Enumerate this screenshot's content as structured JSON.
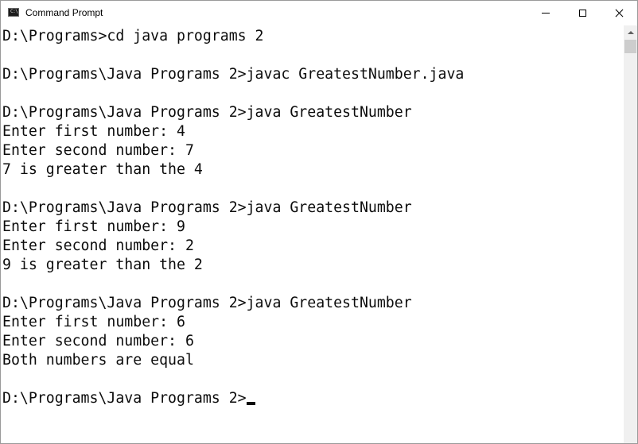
{
  "window": {
    "title": "Command Prompt",
    "icon_name": "command-prompt-icon",
    "icon_glyph": "C:\\",
    "controls": {
      "minimize": "minimize-icon",
      "maximize": "maximize-icon",
      "close": "close-icon"
    }
  },
  "console": {
    "lines": [
      "D:\\Programs>cd java programs 2",
      "",
      "D:\\Programs\\Java Programs 2>javac GreatestNumber.java",
      "",
      "D:\\Programs\\Java Programs 2>java GreatestNumber",
      "Enter first number: 4",
      "Enter second number: 7",
      "7 is greater than the 4",
      "",
      "D:\\Programs\\Java Programs 2>java GreatestNumber",
      "Enter first number: 9",
      "Enter second number: 2",
      "9 is greater than the 2",
      "",
      "D:\\Programs\\Java Programs 2>java GreatestNumber",
      "Enter first number: 6",
      "Enter second number: 6",
      "Both numbers are equal",
      "",
      "D:\\Programs\\Java Programs 2>"
    ],
    "background_color": "#ffffff",
    "text_color": "#0c0c0c"
  }
}
